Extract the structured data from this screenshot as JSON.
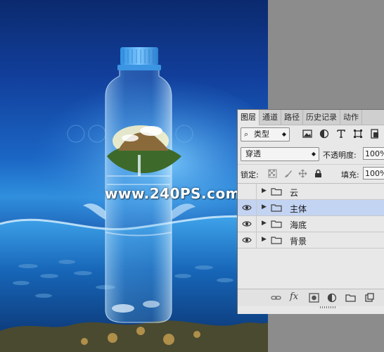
{
  "canvas": {
    "watermark": "www.240PS.com"
  },
  "panel": {
    "tabs": [
      {
        "label": "图层",
        "active": true
      },
      {
        "label": "通道",
        "active": false
      },
      {
        "label": "路径",
        "active": false
      },
      {
        "label": "历史记录",
        "active": false
      },
      {
        "label": "动作",
        "active": false
      }
    ],
    "filter": {
      "kind_label": "类型",
      "icons": [
        "image-filter-icon",
        "adjustment-filter-icon",
        "type-filter-icon",
        "shape-filter-icon",
        "smart-object-filter-icon"
      ]
    },
    "blend": {
      "mode": "穿透",
      "opacity_label": "不透明度:",
      "opacity_value": "100%"
    },
    "lock": {
      "label": "锁定:",
      "icons": [
        "lock-transparent-icon",
        "lock-image-icon",
        "lock-position-icon",
        "lock-all-icon"
      ],
      "fill_label": "填充:",
      "fill_value": "100%"
    },
    "layers": [
      {
        "name": "云",
        "visible": false,
        "selected": false
      },
      {
        "name": "主体",
        "visible": true,
        "selected": true
      },
      {
        "name": "海底",
        "visible": true,
        "selected": false
      },
      {
        "name": "背景",
        "visible": true,
        "selected": false
      }
    ],
    "bottom_icons": [
      "link-layers-icon",
      "fx-icon",
      "layer-mask-icon",
      "adjustment-layer-icon",
      "new-group-icon",
      "new-layer-icon"
    ],
    "fx_label": "fx"
  },
  "colors": {
    "panel_bg": "#e8e8e8",
    "selected_row": "#c3d3f2",
    "workspace": "#8c8c8c"
  }
}
